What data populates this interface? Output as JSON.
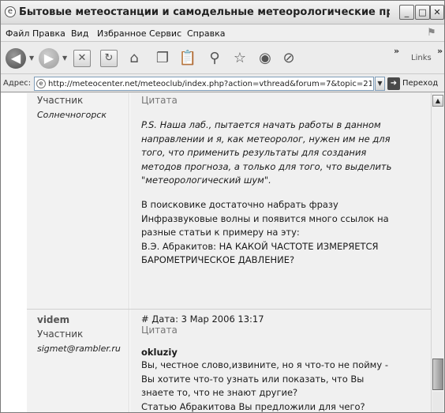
{
  "window": {
    "title": "Бытовые метеостанции и самодельные метеорологические приборы ...",
    "icon": "ie-icon",
    "controls": {
      "minimize": "_",
      "maximize": "□",
      "close": "✕"
    }
  },
  "menubar": {
    "items": [
      "Файл",
      "Правка",
      "Вид",
      "Избранное",
      "Сервис",
      "Справка"
    ]
  },
  "toolbar": {
    "buttons": [
      "back",
      "forward",
      "stop",
      "refresh",
      "home",
      "copy",
      "paste",
      "search",
      "favorites",
      "media",
      "history"
    ],
    "overflow_chevron": "»",
    "links_label": "Links",
    "links_chevron": "»"
  },
  "addressbar": {
    "label": "Адрес:",
    "url": "http://meteocenter.net/meteoclub/index.php?action=vthread&forum=7&topic=21",
    "go_label": "Переход"
  },
  "posts": [
    {
      "author_role": "Участник",
      "author_location": "Солнечногорск",
      "quote_label": "Цитата",
      "quote_lines": [
        "P.S. Наша лаб., пытается начать работы в данном",
        "направлении и я, как метеоролог, нужен им не для",
        "того, что применить результаты для создания",
        "методов прогноза, а только для того, что выделить",
        "\"метеорологический шум\"."
      ],
      "text_lines": [
        "В поисковике достаточно набрать фразу",
        "Инфразвуковые волны и появится много ссылок на",
        "разные статьи к примеру на эту:",
        "В.Э. Абракитов: НА КАКОЙ ЧАСТОТЕ ИЗМЕРЯЕТСЯ",
        "БАРОМЕТРИЧЕСКОЕ ДАВЛЕНИЕ?"
      ]
    },
    {
      "author_name": "videm",
      "author_role": "Участник",
      "author_email": "sigmet@rambler.ru",
      "date_line": "# Дата: 3 Мар 2006 13:17",
      "quote_label": "Цитата",
      "quoted_author": "okluziy",
      "text_lines": [
        "Вы, честное слово,извините, но я что-то не пойму -",
        "Вы хотите что-то узнать или показать, что Вы",
        "знаете то, что не знают другие?",
        "Статью Абракитова Вы предложили для чего?"
      ]
    }
  ]
}
